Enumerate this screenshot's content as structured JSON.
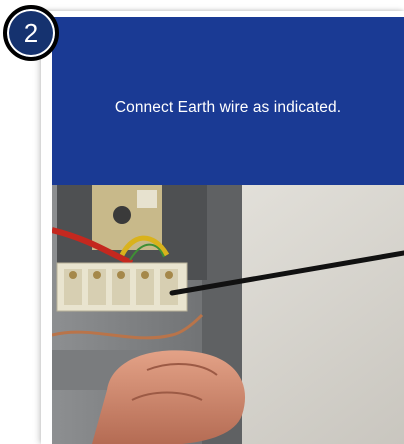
{
  "step": {
    "number": "2",
    "instruction": "Connect Earth wire as indicated."
  },
  "photo": {
    "icon": "photo-wiring-earth-terminal"
  }
}
